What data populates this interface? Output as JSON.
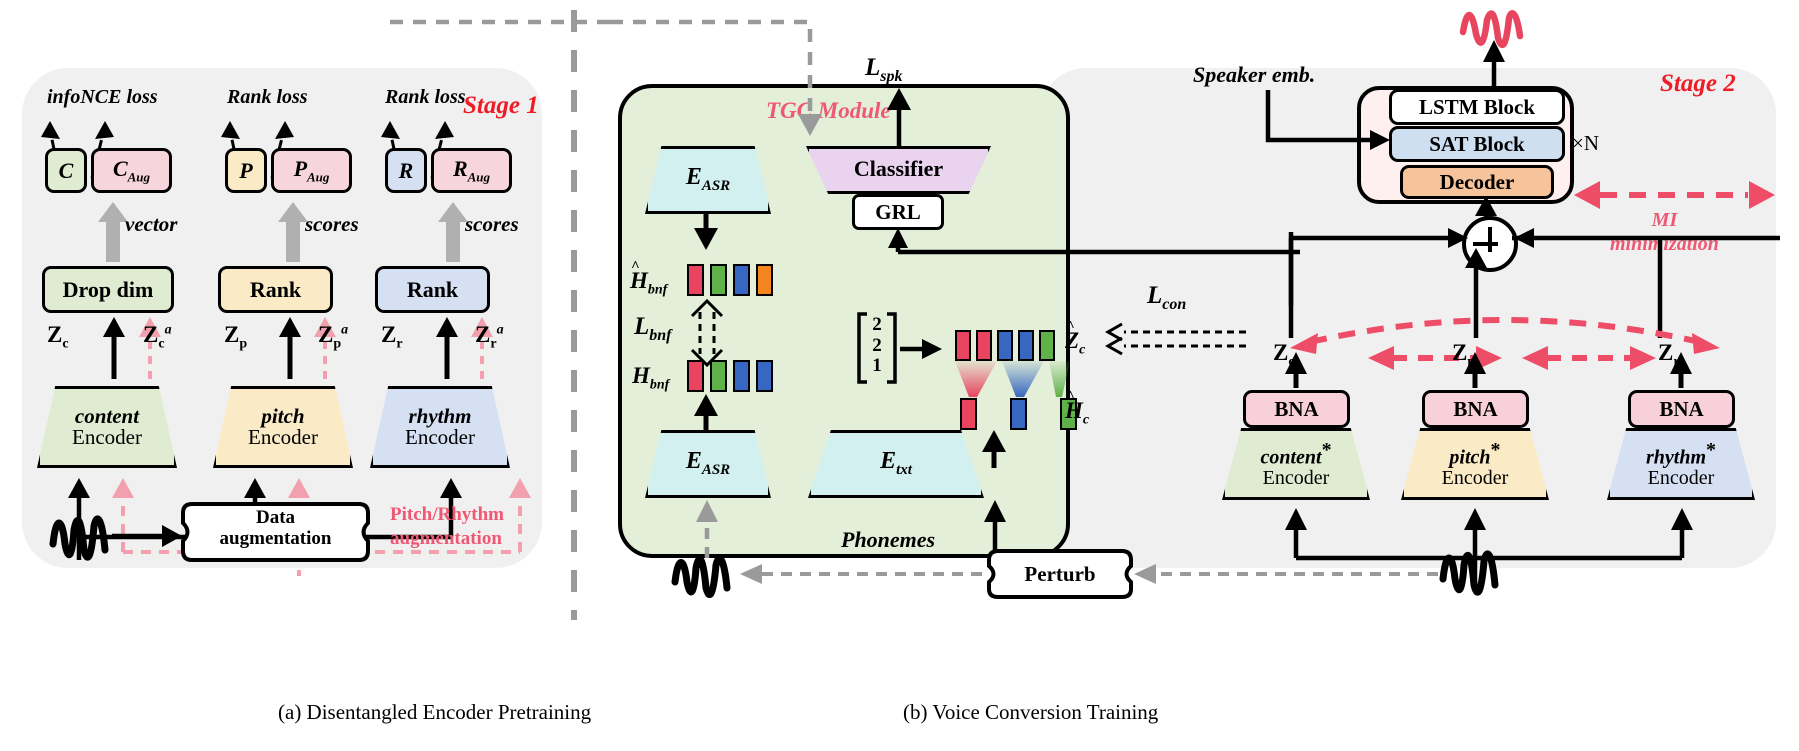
{
  "figure": {
    "caption_a": "(a) Disentangled Encoder Pretraining",
    "caption_b": "(b) Voice Conversion Training"
  },
  "stage1": {
    "badge": "Stage 1",
    "losses": [
      {
        "name": "infoNCE loss",
        "left_box": "C",
        "right_box": "C",
        "right_sub": "Aug"
      },
      {
        "name": "Rank loss",
        "left_box": "P",
        "right_box": "P",
        "right_sub": "Aug"
      },
      {
        "name": "Rank loss",
        "left_box": "R",
        "right_box": "R",
        "right_sub": "Aug"
      }
    ],
    "flow_labels": [
      "vector",
      "scores",
      "scores"
    ],
    "op_boxes": [
      "Drop dim",
      "Rank",
      "Rank"
    ],
    "latents": [
      "Z",
      "Z",
      "Z"
    ],
    "latent_subs": [
      "c",
      "p",
      "r"
    ],
    "latent_aug_sup": "a",
    "encoders": [
      {
        "em": "content",
        "plain": "Encoder"
      },
      {
        "em": "pitch",
        "plain": "Encoder"
      },
      {
        "em": "rhythm",
        "plain": "Encoder"
      }
    ],
    "data_aug": {
      "line1": "Data",
      "line2": "augmentation"
    },
    "aug_note": {
      "line1": "Pitch/Rhythm",
      "line2": "augmentation"
    }
  },
  "stage2": {
    "badge": "Stage 2",
    "tgc_title": "TGC Module",
    "loss_spk": "L",
    "loss_spk_sub": "spk",
    "loss_bnf": "L",
    "loss_bnf_sub": "bnf",
    "loss_con": "L",
    "loss_con_sub": "con",
    "e_asr_top": "E",
    "e_asr_top_sub": "ASR",
    "e_asr_bottom": "E",
    "e_asr_bottom_sub": "ASR",
    "e_txt": "E",
    "e_txt_sub": "txt",
    "classifier": "Classifier",
    "grl": "GRL",
    "h_bnf_hat": "H",
    "h_bnf_hat_sub": "bnf",
    "h_bnf": "H",
    "h_bnf_sub": "bnf",
    "z_c_hat": "Z",
    "z_c_hat_sub": "c",
    "h_c_hat": "H",
    "h_c_hat_sub": "c",
    "duration_vector": [
      "2",
      "2",
      "1"
    ],
    "h_bnf_hat_colors": [
      "#e8445f",
      "#5fb14a",
      "#3767c0",
      "#f5861f"
    ],
    "h_bnf_colors": [
      "#e8445f",
      "#5fb14a",
      "#3767c0",
      "#3767c0"
    ],
    "z_c_hat_colors": [
      "#e8445f",
      "#e8445f",
      "#3767c0",
      "#3767c0",
      "#5fb14a"
    ],
    "h_c_hat_colors": [
      "#e8445f",
      "#3767c0",
      "#5fb14a"
    ],
    "speaker_emb": "Speaker emb.",
    "decoder_stack": [
      {
        "label": "LSTM Block",
        "color": "#ffffff"
      },
      {
        "label": "SAT Block",
        "color": "#cfdff2"
      },
      {
        "label": "Decoder",
        "color": "#f6c39a"
      }
    ],
    "repeat_n": "×N",
    "mi_note": {
      "line1": "MI",
      "line2": "minimization"
    },
    "bna_label": "BNA",
    "latents": [
      "Z",
      "Z",
      "Z"
    ],
    "latent_subs": [
      "c",
      "p",
      "r"
    ],
    "encoders": [
      {
        "em": "content",
        "star": "*",
        "plain": "Encoder"
      },
      {
        "em": "pitch",
        "star": "*",
        "plain": "Encoder"
      },
      {
        "em": "rhythm",
        "star": "*",
        "plain": "Encoder"
      }
    ],
    "phonemes": "Phonemes",
    "perturb": "Perturb"
  },
  "colors": {
    "content_green": "#dfecd2",
    "pitch_yellow": "#fbeac6",
    "rhythm_blue": "#d6e0f3",
    "aug_pink": "#f7d5dc",
    "cyan": "#d3f0f0",
    "purple": "#e9d3ef",
    "bna_pink": "#f7d0da",
    "accent_red": "#ee1c25",
    "accent_pink": "#ef5873",
    "panel_gray": "#f0f0f0"
  }
}
